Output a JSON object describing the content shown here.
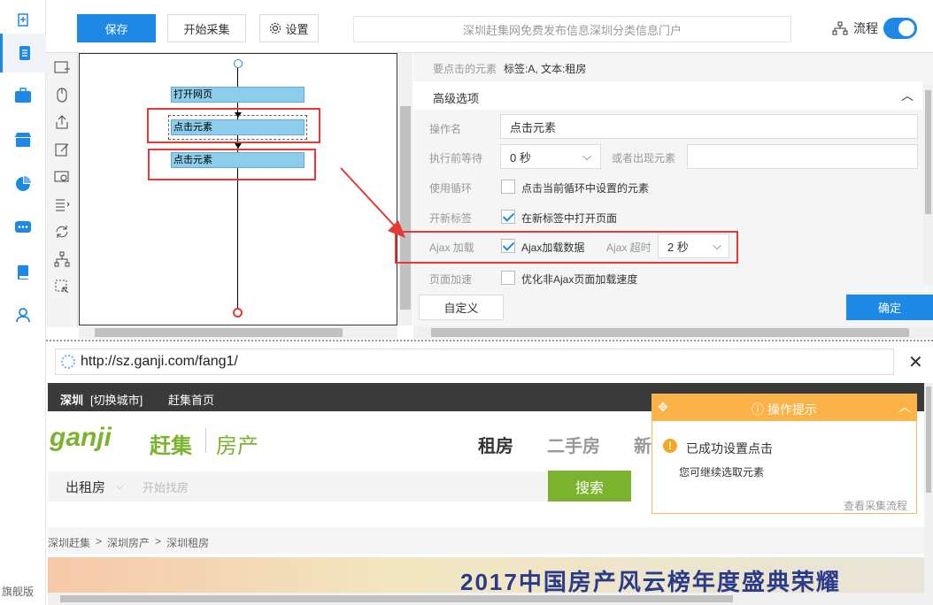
{
  "sidebar": {
    "edition_label": "旗舰版"
  },
  "toolbar": {
    "save_label": "保存",
    "start_label": "开始采集",
    "settings_label": "设置",
    "title_text": "深圳赶集网免费发布信息深圳分类信息门户",
    "flow_label": "流程"
  },
  "flow": {
    "nodes": [
      "打开网页",
      "点击元素",
      "点击元素"
    ]
  },
  "panel": {
    "target_label": "要点击的元素",
    "target_value": "标签:A, 文本:租房",
    "advanced_label": "高级选项",
    "op_name_label": "操作名",
    "op_name_value": "点击元素",
    "wait_label": "执行前等待",
    "wait_value": "0 秒",
    "or_appear_label": "或者出现元素",
    "loop_label": "使用循环",
    "loop_check_label": "点击当前循环中设置的元素",
    "newtab_label": "开新标签",
    "newtab_check_label": "在新标签中打开页面",
    "ajax_label": "Ajax 加载",
    "ajax_check_label": "Ajax加载数据",
    "ajax_timeout_label": "Ajax 超时",
    "ajax_timeout_value": "2 秒",
    "speed_label": "页面加速",
    "speed_check_label": "优化非Ajax页面加载速度",
    "custom_label": "自定义",
    "ok_label": "确定"
  },
  "browser": {
    "url": "http://sz.ganji.com/fang1/",
    "city": "深圳",
    "switch_city": "[切换城市]",
    "home": "赶集首页",
    "logo_text": "ganji",
    "logo_cn": "赶集",
    "logo_section": "房产",
    "nav": [
      "租房",
      "二手房",
      "新"
    ],
    "search_type": "出租房",
    "search_placeholder": "开始找房",
    "search_button": "搜索",
    "breadcrumb": [
      "深圳赶集",
      "深圳房产",
      "深圳租房"
    ],
    "banner_text": "2017中国房产风云榜年度盛典荣耀"
  },
  "popup": {
    "title": "操作提示",
    "message": "已成功设置点击",
    "sub": "您可继续选取元素",
    "link": "查看采集流程"
  },
  "colors": {
    "accent": "#1e88e5",
    "highlight": "#e53935",
    "popup": "#fbb246",
    "search": "#7cb32e"
  }
}
